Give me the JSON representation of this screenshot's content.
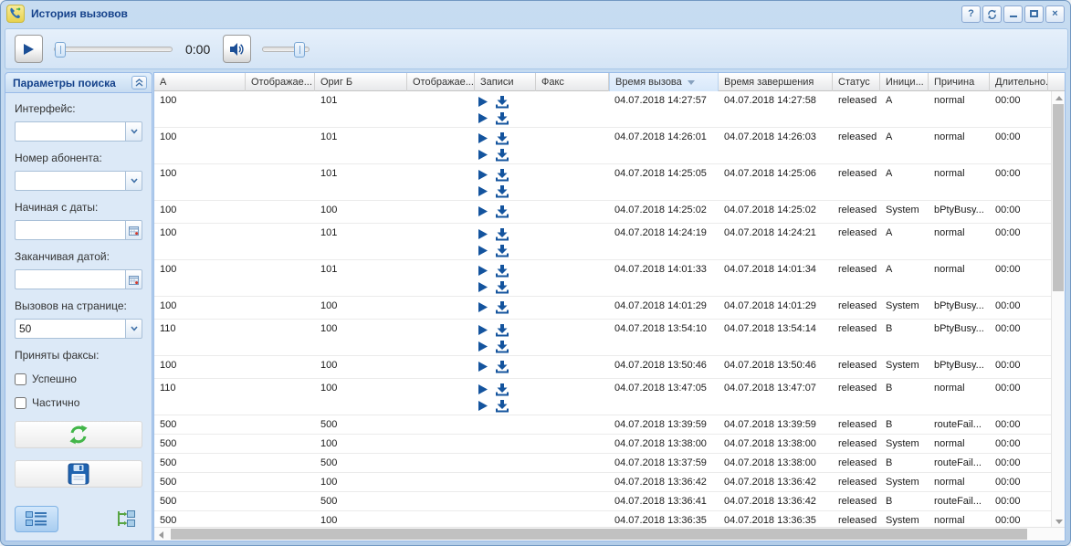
{
  "window": {
    "title": "История вызовов",
    "help_glyph": "?"
  },
  "player": {
    "time": "0:00"
  },
  "sidebar": {
    "header": "Параметры поиска",
    "interface_label": "Интерфейс:",
    "subscriber_label": "Номер абонента:",
    "start_date_label": "Начиная с даты:",
    "end_date_label": "Заканчивая датой:",
    "per_page_label": "Вызовов на странице:",
    "per_page_value": "50",
    "fax_label": "Приняты факсы:",
    "fax_success": "Успешно",
    "fax_partial": "Частично"
  },
  "table": {
    "columns": [
      {
        "label": "А"
      },
      {
        "label": "Отображае..."
      },
      {
        "label": "Ориг Б"
      },
      {
        "label": "Отображае..."
      },
      {
        "label": "Записи"
      },
      {
        "label": "Факс"
      },
      {
        "label": "Время вызова",
        "sorted": "desc"
      },
      {
        "label": "Время завершения"
      },
      {
        "label": "Статус"
      },
      {
        "label": "Иници..."
      },
      {
        "label": "Причина"
      },
      {
        "label": "Длительно..."
      }
    ],
    "rows": [
      {
        "a": "100",
        "a_disp": "",
        "b": "101",
        "b_disp": "",
        "records": 2,
        "fax": "",
        "time_start": "04.07.2018 14:27:57",
        "time_end": "04.07.2018 14:27:58",
        "status": "released",
        "initiator": "A",
        "reason": "normal",
        "duration": "00:00"
      },
      {
        "a": "100",
        "a_disp": "",
        "b": "101",
        "b_disp": "",
        "records": 2,
        "fax": "",
        "time_start": "04.07.2018 14:26:01",
        "time_end": "04.07.2018 14:26:03",
        "status": "released",
        "initiator": "A",
        "reason": "normal",
        "duration": "00:00"
      },
      {
        "a": "100",
        "a_disp": "",
        "b": "101",
        "b_disp": "",
        "records": 2,
        "fax": "",
        "time_start": "04.07.2018 14:25:05",
        "time_end": "04.07.2018 14:25:06",
        "status": "released",
        "initiator": "A",
        "reason": "normal",
        "duration": "00:00"
      },
      {
        "a": "100",
        "a_disp": "",
        "b": "100",
        "b_disp": "",
        "records": 1,
        "fax": "",
        "time_start": "04.07.2018 14:25:02",
        "time_end": "04.07.2018 14:25:02",
        "status": "released",
        "initiator": "System",
        "reason": "bPtyBusy...",
        "duration": "00:00"
      },
      {
        "a": "100",
        "a_disp": "",
        "b": "101",
        "b_disp": "",
        "records": 2,
        "fax": "",
        "time_start": "04.07.2018 14:24:19",
        "time_end": "04.07.2018 14:24:21",
        "status": "released",
        "initiator": "A",
        "reason": "normal",
        "duration": "00:00"
      },
      {
        "a": "100",
        "a_disp": "",
        "b": "101",
        "b_disp": "",
        "records": 2,
        "fax": "",
        "time_start": "04.07.2018 14:01:33",
        "time_end": "04.07.2018 14:01:34",
        "status": "released",
        "initiator": "A",
        "reason": "normal",
        "duration": "00:00"
      },
      {
        "a": "100",
        "a_disp": "",
        "b": "100",
        "b_disp": "",
        "records": 1,
        "fax": "",
        "time_start": "04.07.2018 14:01:29",
        "time_end": "04.07.2018 14:01:29",
        "status": "released",
        "initiator": "System",
        "reason": "bPtyBusy...",
        "duration": "00:00"
      },
      {
        "a": "110",
        "a_disp": "",
        "b": "100",
        "b_disp": "",
        "records": 2,
        "fax": "",
        "time_start": "04.07.2018 13:54:10",
        "time_end": "04.07.2018 13:54:14",
        "status": "released",
        "initiator": "B",
        "reason": "bPtyBusy...",
        "duration": "00:00"
      },
      {
        "a": "100",
        "a_disp": "",
        "b": "100",
        "b_disp": "",
        "records": 1,
        "fax": "",
        "time_start": "04.07.2018 13:50:46",
        "time_end": "04.07.2018 13:50:46",
        "status": "released",
        "initiator": "System",
        "reason": "bPtyBusy...",
        "duration": "00:00"
      },
      {
        "a": "110",
        "a_disp": "",
        "b": "100",
        "b_disp": "",
        "records": 2,
        "fax": "",
        "time_start": "04.07.2018 13:47:05",
        "time_end": "04.07.2018 13:47:07",
        "status": "released",
        "initiator": "B",
        "reason": "normal",
        "duration": "00:00"
      },
      {
        "a": "500",
        "a_disp": "",
        "b": "500",
        "b_disp": "",
        "records": 0,
        "fax": "",
        "time_start": "04.07.2018 13:39:59",
        "time_end": "04.07.2018 13:39:59",
        "status": "released",
        "initiator": "B",
        "reason": "routeFail...",
        "duration": "00:00"
      },
      {
        "a": "500",
        "a_disp": "",
        "b": "100",
        "b_disp": "",
        "records": 0,
        "fax": "",
        "time_start": "04.07.2018 13:38:00",
        "time_end": "04.07.2018 13:38:00",
        "status": "released",
        "initiator": "System",
        "reason": "normal",
        "duration": "00:00"
      },
      {
        "a": "500",
        "a_disp": "",
        "b": "500",
        "b_disp": "",
        "records": 0,
        "fax": "",
        "time_start": "04.07.2018 13:37:59",
        "time_end": "04.07.2018 13:38:00",
        "status": "released",
        "initiator": "B",
        "reason": "routeFail...",
        "duration": "00:00"
      },
      {
        "a": "500",
        "a_disp": "",
        "b": "100",
        "b_disp": "",
        "records": 0,
        "fax": "",
        "time_start": "04.07.2018 13:36:42",
        "time_end": "04.07.2018 13:36:42",
        "status": "released",
        "initiator": "System",
        "reason": "normal",
        "duration": "00:00"
      },
      {
        "a": "500",
        "a_disp": "",
        "b": "500",
        "b_disp": "",
        "records": 0,
        "fax": "",
        "time_start": "04.07.2018 13:36:41",
        "time_end": "04.07.2018 13:36:42",
        "status": "released",
        "initiator": "B",
        "reason": "routeFail...",
        "duration": "00:00"
      },
      {
        "a": "500",
        "a_disp": "",
        "b": "100",
        "b_disp": "",
        "records": 0,
        "fax": "",
        "time_start": "04.07.2018 13:36:35",
        "time_end": "04.07.2018 13:36:35",
        "status": "released",
        "initiator": "System",
        "reason": "normal",
        "duration": "00:00"
      }
    ]
  },
  "colors": {
    "title_text": "#15428b",
    "record_icon": "#14549e",
    "refresh_green": "#43b649",
    "save_blue": "#1f63b0",
    "sorted_header_bg": "#ddeafa"
  },
  "icons": {
    "titlebar": [
      "call-history-icon"
    ],
    "window_controls": [
      "help-icon",
      "refresh-icon",
      "minimize-icon",
      "maximize-icon",
      "close-icon"
    ],
    "player": [
      "play-icon",
      "volume-icon"
    ],
    "sidebar": [
      "collapse-icon",
      "dropdown-icon",
      "calendar-icon",
      "refresh-arrows-icon",
      "save-floppy-icon",
      "list-view-icon",
      "tree-view-icon"
    ],
    "records": [
      "play-record-icon",
      "download-record-icon"
    ]
  }
}
